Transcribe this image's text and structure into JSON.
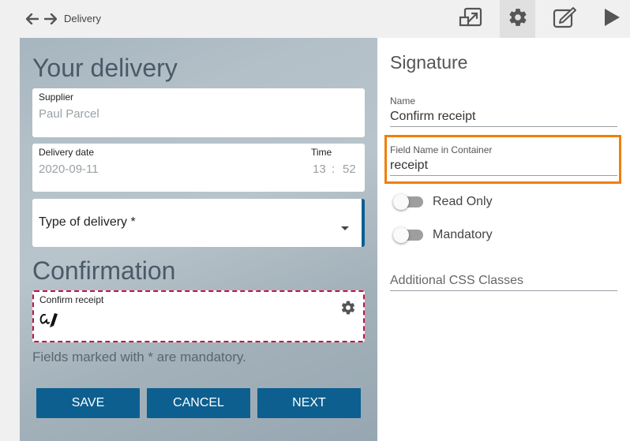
{
  "topbar": {
    "breadcrumb": "Delivery",
    "icons": [
      "arrow-left-icon",
      "arrow-right-icon",
      "resize-icon",
      "gear-icon",
      "edit-icon",
      "play-icon"
    ]
  },
  "form": {
    "title": "Your delivery",
    "supplier": {
      "label": "Supplier",
      "value": "Paul Parcel"
    },
    "delivery_date": {
      "label": "Delivery date",
      "value": "2020-09-11"
    },
    "time": {
      "label": "Time",
      "hour": "13",
      "separator": ":",
      "minute": "52"
    },
    "type_of_delivery": {
      "label": "Type of delivery *"
    },
    "confirmation_title": "Confirmation",
    "confirm_receipt": {
      "label": "Confirm receipt"
    },
    "mandatory_note": "Fields marked with * are mandatory.",
    "buttons": {
      "save": "SAVE",
      "cancel": "CANCEL",
      "next": "NEXT"
    }
  },
  "panel": {
    "title": "Signature",
    "name": {
      "label": "Name",
      "value": "Confirm receipt"
    },
    "field_name": {
      "label": "Field Name in Container",
      "value": "receipt"
    },
    "read_only": {
      "label": "Read Only",
      "on": false
    },
    "mandatory": {
      "label": "Mandatory",
      "on": false
    },
    "css_classes": {
      "placeholder": "Additional CSS Classes"
    }
  },
  "colors": {
    "accent": "#0d5f8f",
    "highlight": "#f07f09",
    "signature_border": "#c8103f"
  }
}
